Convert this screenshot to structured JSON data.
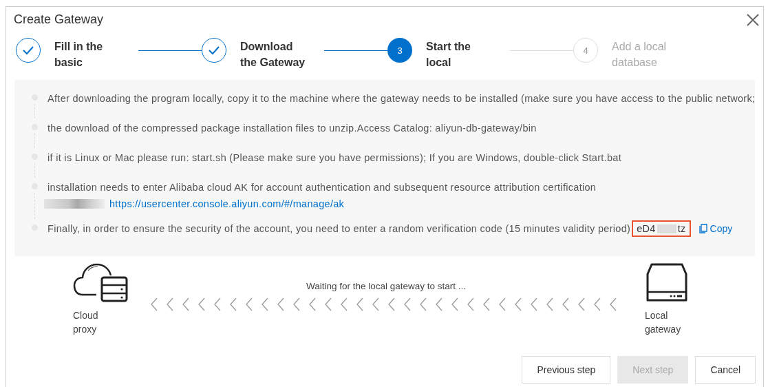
{
  "dialog": {
    "title": "Create Gateway"
  },
  "steps": [
    {
      "label": "Fill in the basic",
      "completed": true,
      "selected": false
    },
    {
      "label": "Download the Gateway",
      "completed": true,
      "selected": false
    },
    {
      "number": "3",
      "label": "Start the local",
      "completed": false,
      "selected": true
    },
    {
      "number": "4",
      "label": "Add a local database",
      "completed": false,
      "selected": false
    }
  ],
  "instructions": [
    {
      "text": "After downloading the program locally, copy it to the machine where the gateway needs to be installed (make sure you have access to the public network;"
    },
    {
      "text": "the download of the compressed package installation files to unzip.Access Catalog: aliyun-db-gateway/bin"
    },
    {
      "text": "if it is Linux or Mac please run: start.sh (Please make sure you have permissions); If you are Windows, double-click Start.bat"
    },
    {
      "text": "installation needs to enter Alibaba cloud AK for account authentication and subsequent resource attribution certification",
      "link": "https://usercenter.console.aliyun.com/#/manage/ak"
    },
    {
      "text": "Finally, in order to ensure the security of the account, you need to enter a random verification code (15 minutes validity period)",
      "code_start": "eD4",
      "code_end": "tz",
      "copy": "Copy"
    }
  ],
  "diagram": {
    "source": "Cloud proxy",
    "status": "Waiting for the local gateway to start ...",
    "target": "Local gateway"
  },
  "buttons": [
    {
      "label": "Previous step",
      "disabled": false
    },
    {
      "label": "Next step",
      "disabled": true
    },
    {
      "label": "Cancel",
      "disabled": false
    }
  ]
}
